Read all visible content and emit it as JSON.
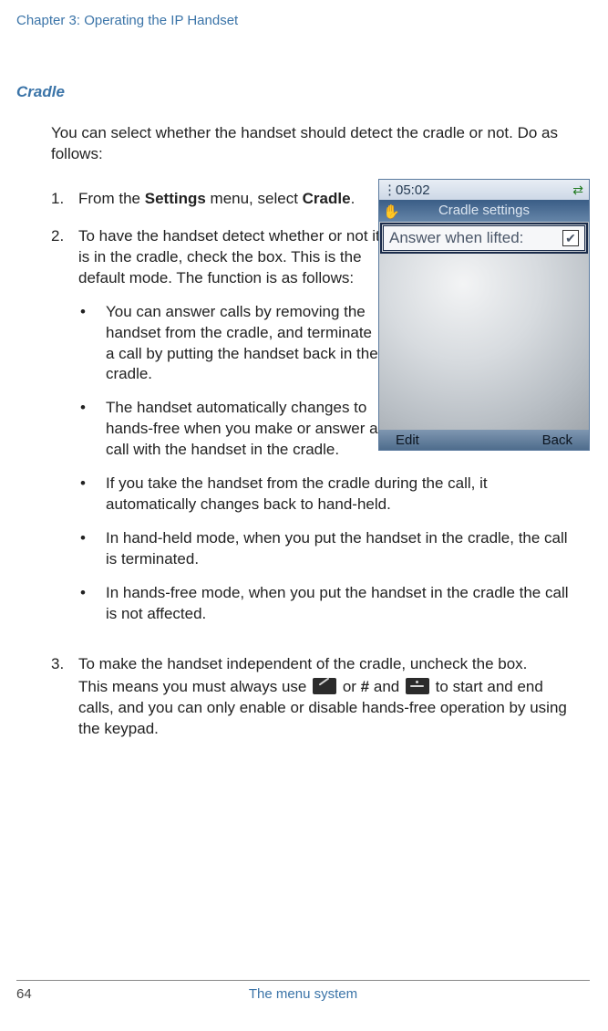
{
  "header": {
    "chapter": "Chapter 3:  Operating the IP Handset"
  },
  "section": {
    "title": "Cradle"
  },
  "intro": "You can select whether the handset should detect the cradle or not. Do as follows:",
  "steps": {
    "s1": {
      "num": "1.",
      "pre": "From the ",
      "b1": "Settings",
      "mid": " menu, select ",
      "b2": "Cradle",
      "post": "."
    },
    "s2": {
      "num": "2.",
      "text": "To have the handset detect whether or not it is in the cradle, check the box. This is the default mode. The function is as follows:",
      "bullets": {
        "b1": "You can answer calls by removing the handset from the cradle, and terminate a call by putting the handset back in the cradle.",
        "b2": "The handset automatically changes to hands-free when you make or answer a call with the handset in the cradle.",
        "b3": "If you take the handset from the cradle during the call, it automatically changes back to hand-held.",
        "b4": "In hand-held mode, when you put the handset in the cradle, the call is terminated.",
        "b5": "In hands-free mode, when you put the handset in the cradle the call is not affected."
      }
    },
    "s3": {
      "num": "3.",
      "line1": "To make the handset independent of the cradle, uncheck the box.",
      "line2a": "This means you must always use ",
      "line2b": " or ",
      "hash": "#",
      "line2c": " and ",
      "line2d": " to start and end calls, and you can only enable or disable hands-free operation by using the keypad."
    }
  },
  "phone": {
    "time": "05:02",
    "title": "Cradle settings",
    "row_label": "Answer when lifted:",
    "checked": "✔",
    "soft_left": "Edit",
    "soft_right": "Back"
  },
  "footer": {
    "page": "64",
    "title": "The menu system"
  }
}
